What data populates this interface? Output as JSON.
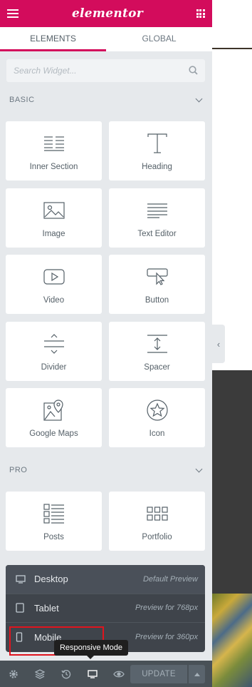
{
  "header": {
    "logo": "elementor"
  },
  "tabs": [
    {
      "label": "ELEMENTS",
      "active": true
    },
    {
      "label": "GLOBAL",
      "active": false
    }
  ],
  "search": {
    "placeholder": "Search Widget..."
  },
  "sections": {
    "basic": {
      "title": "BASIC",
      "widgets": [
        {
          "label": "Inner Section",
          "icon": "inner-section-icon"
        },
        {
          "label": "Heading",
          "icon": "heading-icon"
        },
        {
          "label": "Image",
          "icon": "image-icon"
        },
        {
          "label": "Text Editor",
          "icon": "text-editor-icon"
        },
        {
          "label": "Video",
          "icon": "video-icon"
        },
        {
          "label": "Button",
          "icon": "button-icon"
        },
        {
          "label": "Divider",
          "icon": "divider-icon"
        },
        {
          "label": "Spacer",
          "icon": "spacer-icon"
        },
        {
          "label": "Google Maps",
          "icon": "google-maps-icon"
        },
        {
          "label": "Icon",
          "icon": "star-icon"
        }
      ]
    },
    "pro": {
      "title": "PRO",
      "widgets": [
        {
          "label": "Posts",
          "icon": "posts-icon"
        },
        {
          "label": "Portfolio",
          "icon": "portfolio-icon"
        }
      ]
    }
  },
  "responsive": {
    "items": [
      {
        "label": "Desktop",
        "desc": "Default Preview",
        "icon": "desktop-icon"
      },
      {
        "label": "Tablet",
        "desc": "Preview for 768px",
        "icon": "tablet-icon"
      },
      {
        "label": "Mobile",
        "desc": "Preview for 360px",
        "icon": "mobile-icon"
      }
    ],
    "tooltip": "Responsive Mode"
  },
  "footer": {
    "icons": [
      "settings-icon",
      "navigator-icon",
      "history-icon",
      "responsive-icon",
      "preview-icon"
    ],
    "update_label": "UPDATE"
  },
  "colors": {
    "brand": "#d30c5c",
    "panel": "#e6e9ec",
    "footer": "#495157",
    "highlight": "#e0141e"
  }
}
